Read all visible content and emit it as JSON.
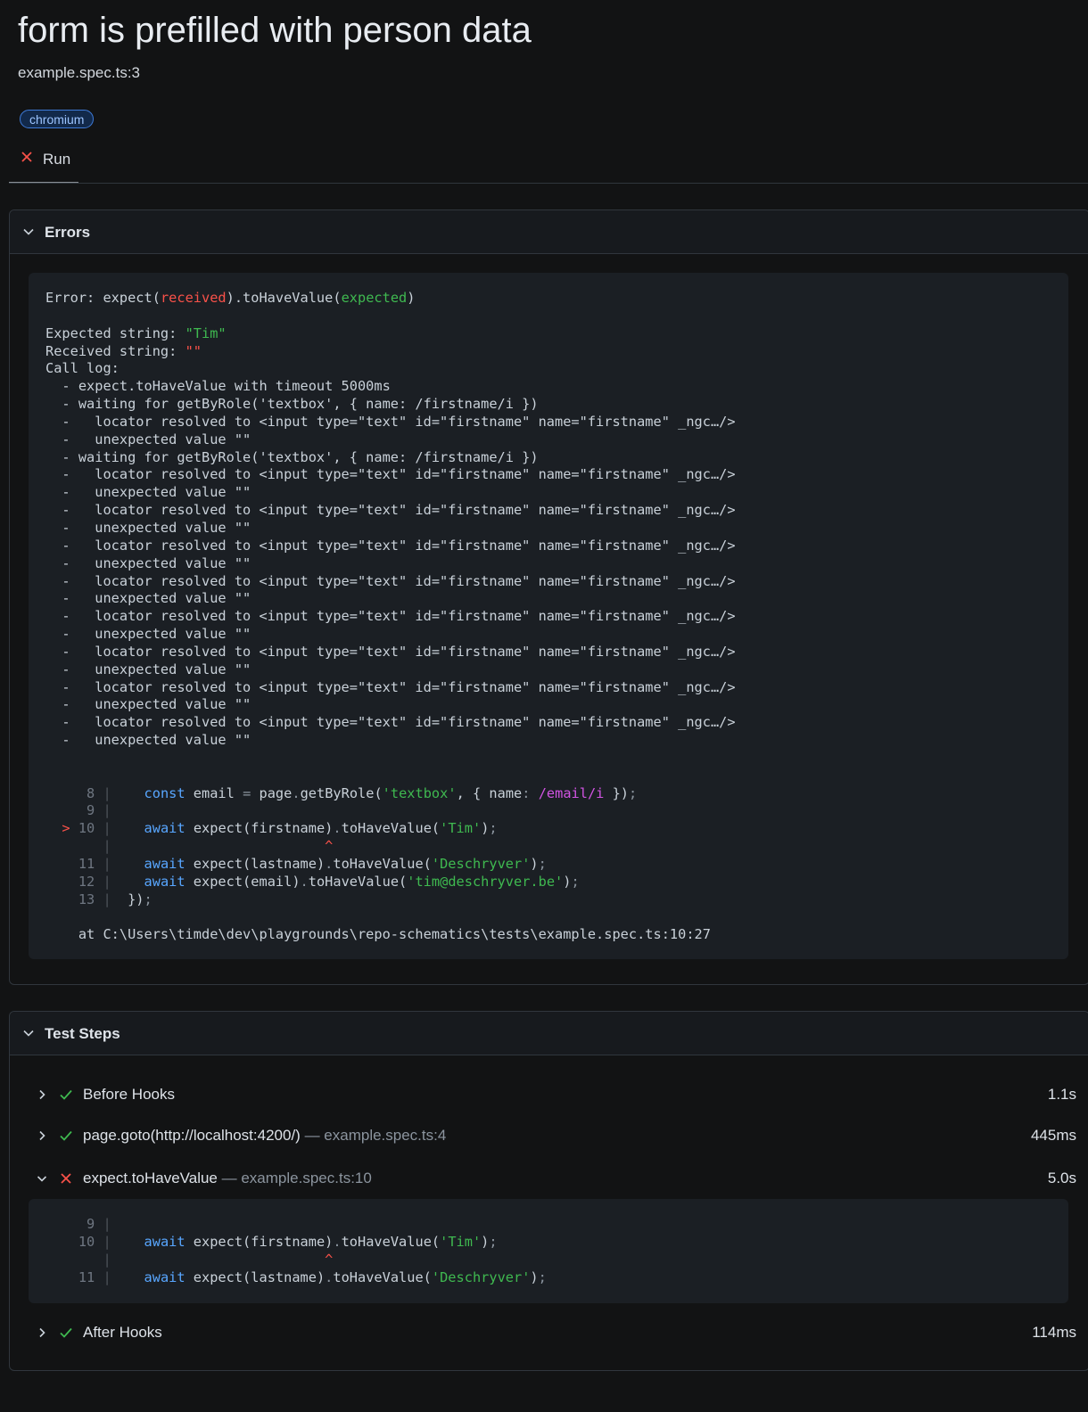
{
  "header": {
    "title": "form is prefilled with person data",
    "location": "example.spec.ts:3",
    "project_chip": "chromium",
    "run_tab": "Run"
  },
  "errors": {
    "title": "Errors",
    "lines": [
      [
        {
          "t": "Error: expect("
        },
        {
          "t": "received",
          "c": "red"
        },
        {
          "t": ").toHaveValue("
        },
        {
          "t": "expected",
          "c": "green"
        },
        {
          "t": ")"
        }
      ],
      [],
      [
        {
          "t": "Expected string: "
        },
        {
          "t": "\"Tim\"",
          "c": "green"
        }
      ],
      [
        {
          "t": "Received string: "
        },
        {
          "t": "\"\"",
          "c": "red"
        }
      ],
      [
        {
          "t": "Call log:"
        }
      ],
      [
        {
          "t": "  - expect.toHaveValue with timeout 5000ms"
        }
      ],
      [
        {
          "t": "  - waiting for getByRole('textbox', { name: /firstname/i })"
        }
      ],
      [
        {
          "t": "  -   locator resolved to <input type=\"text\" id=\"firstname\" name=\"firstname\" _ngc…/>"
        }
      ],
      [
        {
          "t": "  -   unexpected value \"\""
        }
      ],
      [
        {
          "t": "  - waiting for getByRole('textbox', { name: /firstname/i })"
        }
      ],
      [
        {
          "t": "  -   locator resolved to <input type=\"text\" id=\"firstname\" name=\"firstname\" _ngc…/>"
        }
      ],
      [
        {
          "t": "  -   unexpected value \"\""
        }
      ],
      [
        {
          "t": "  -   locator resolved to <input type=\"text\" id=\"firstname\" name=\"firstname\" _ngc…/>"
        }
      ],
      [
        {
          "t": "  -   unexpected value \"\""
        }
      ],
      [
        {
          "t": "  -   locator resolved to <input type=\"text\" id=\"firstname\" name=\"firstname\" _ngc…/>"
        }
      ],
      [
        {
          "t": "  -   unexpected value \"\""
        }
      ],
      [
        {
          "t": "  -   locator resolved to <input type=\"text\" id=\"firstname\" name=\"firstname\" _ngc…/>"
        }
      ],
      [
        {
          "t": "  -   unexpected value \"\""
        }
      ],
      [
        {
          "t": "  -   locator resolved to <input type=\"text\" id=\"firstname\" name=\"firstname\" _ngc…/>"
        }
      ],
      [
        {
          "t": "  -   unexpected value \"\""
        }
      ],
      [
        {
          "t": "  -   locator resolved to <input type=\"text\" id=\"firstname\" name=\"firstname\" _ngc…/>"
        }
      ],
      [
        {
          "t": "  -   unexpected value \"\""
        }
      ],
      [
        {
          "t": "  -   locator resolved to <input type=\"text\" id=\"firstname\" name=\"firstname\" _ngc…/>"
        }
      ],
      [
        {
          "t": "  -   unexpected value \"\""
        }
      ],
      [
        {
          "t": "  -   locator resolved to <input type=\"text\" id=\"firstname\" name=\"firstname\" _ngc…/>"
        }
      ],
      [
        {
          "t": "  -   unexpected value \"\""
        }
      ],
      [],
      [],
      [
        {
          "t": "     8 ",
          "c": "lnum"
        },
        {
          "t": "| ",
          "c": "gutter"
        },
        {
          "t": "   "
        },
        {
          "t": "const",
          "c": "kw"
        },
        {
          "t": " email "
        },
        {
          "t": "=",
          "c": "dim"
        },
        {
          "t": " page"
        },
        {
          "t": ".",
          "c": "dim"
        },
        {
          "t": "getByRole("
        },
        {
          "t": "'textbox'",
          "c": "str"
        },
        {
          "t": ", { name"
        },
        {
          "t": ":",
          "c": "dim"
        },
        {
          "t": " "
        },
        {
          "t": "/email/i",
          "c": "re"
        },
        {
          "t": " })"
        },
        {
          "t": ";",
          "c": "dim"
        }
      ],
      [
        {
          "t": "     9 ",
          "c": "lnum"
        },
        {
          "t": "|",
          "c": "gutter"
        }
      ],
      [
        {
          "t": "  ",
          "c": "red"
        },
        {
          "t": "> ",
          "c": "red"
        },
        {
          "t": "10 ",
          "c": "lnum"
        },
        {
          "t": "| ",
          "c": "gutter"
        },
        {
          "t": "   "
        },
        {
          "t": "await",
          "c": "kw"
        },
        {
          "t": " expect(firstname)"
        },
        {
          "t": ".",
          "c": "dim"
        },
        {
          "t": "toHaveValue("
        },
        {
          "t": "'Tim'",
          "c": "str"
        },
        {
          "t": ")"
        },
        {
          "t": ";",
          "c": "dim"
        }
      ],
      [
        {
          "t": "       ",
          "c": "lnum"
        },
        {
          "t": "|",
          "c": "gutter"
        },
        {
          "t": "                          "
        },
        {
          "t": "^",
          "c": "caret"
        }
      ],
      [
        {
          "t": "    11 ",
          "c": "lnum"
        },
        {
          "t": "| ",
          "c": "gutter"
        },
        {
          "t": "   "
        },
        {
          "t": "await",
          "c": "kw"
        },
        {
          "t": " expect(lastname)"
        },
        {
          "t": ".",
          "c": "dim"
        },
        {
          "t": "toHaveValue("
        },
        {
          "t": "'Deschryver'",
          "c": "str"
        },
        {
          "t": ")"
        },
        {
          "t": ";",
          "c": "dim"
        }
      ],
      [
        {
          "t": "    12 ",
          "c": "lnum"
        },
        {
          "t": "| ",
          "c": "gutter"
        },
        {
          "t": "   "
        },
        {
          "t": "await",
          "c": "kw"
        },
        {
          "t": " expect(email)"
        },
        {
          "t": ".",
          "c": "dim"
        },
        {
          "t": "toHaveValue("
        },
        {
          "t": "'tim@deschryver.be'",
          "c": "str"
        },
        {
          "t": ")"
        },
        {
          "t": ";",
          "c": "dim"
        }
      ],
      [
        {
          "t": "    13 ",
          "c": "lnum"
        },
        {
          "t": "| ",
          "c": "gutter"
        },
        {
          "t": " })"
        },
        {
          "t": ";",
          "c": "dim"
        }
      ],
      [],
      [
        {
          "t": "    at C:\\Users\\timde\\dev\\playgrounds\\repo-schematics\\tests\\example.spec.ts:10:27"
        }
      ]
    ]
  },
  "test_steps": {
    "title": "Test Steps",
    "steps": [
      {
        "title": "Before Hooks",
        "location": "",
        "duration": "1.1s",
        "status": "passed",
        "expanded": false
      },
      {
        "title": "page.goto(http://localhost:4200/)",
        "location": " — example.spec.ts:4",
        "duration": "445ms",
        "status": "passed",
        "expanded": false
      },
      {
        "title": "expect.toHaveValue",
        "location": " — example.spec.ts:10",
        "duration": "5.0s",
        "status": "failed",
        "expanded": true
      },
      {
        "title": "After Hooks",
        "location": "",
        "duration": "114ms",
        "status": "passed",
        "expanded": false
      }
    ],
    "snippet_lines": [
      [
        {
          "t": "     9 ",
          "c": "lnum"
        },
        {
          "t": "|",
          "c": "gutter"
        }
      ],
      [
        {
          "t": "    10 ",
          "c": "lnum"
        },
        {
          "t": "| ",
          "c": "gutter"
        },
        {
          "t": "   "
        },
        {
          "t": "await",
          "c": "kw"
        },
        {
          "t": " expect(firstname)"
        },
        {
          "t": ".",
          "c": "dim"
        },
        {
          "t": "toHaveValue("
        },
        {
          "t": "'Tim'",
          "c": "str"
        },
        {
          "t": ")"
        },
        {
          "t": ";",
          "c": "dim"
        }
      ],
      [
        {
          "t": "       ",
          "c": "lnum"
        },
        {
          "t": "|",
          "c": "gutter"
        },
        {
          "t": "                          "
        },
        {
          "t": "^",
          "c": "caret"
        }
      ],
      [
        {
          "t": "    11 ",
          "c": "lnum"
        },
        {
          "t": "| ",
          "c": "gutter"
        },
        {
          "t": "   "
        },
        {
          "t": "await",
          "c": "kw"
        },
        {
          "t": " expect(lastname)"
        },
        {
          "t": ".",
          "c": "dim"
        },
        {
          "t": "toHaveValue("
        },
        {
          "t": "'Deschryver'",
          "c": "str"
        },
        {
          "t": ")"
        },
        {
          "t": ";",
          "c": "dim"
        }
      ]
    ]
  },
  "colors": {
    "background": "#121314",
    "passed": "#3fb950",
    "failed": "#f85149",
    "chip_border": "#3d7ad8"
  }
}
